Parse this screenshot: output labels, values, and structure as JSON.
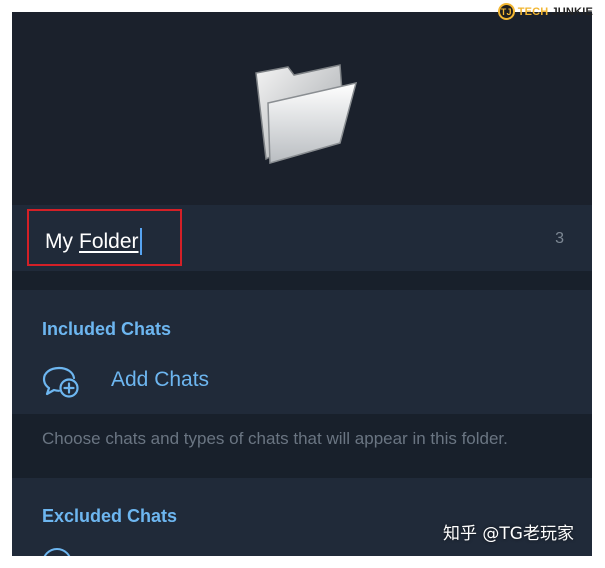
{
  "watermark": {
    "logo": "TJ",
    "brand_a": "TECH",
    "brand_b": "JUNKIE"
  },
  "folder": {
    "icon": "folder-icon"
  },
  "name_field": {
    "value_part1": "My",
    "value_part2": "Folder",
    "char_count": "3"
  },
  "included": {
    "title": "Included Chats",
    "add_label": "Add Chats",
    "add_icon": "add-chat-icon",
    "info": "Choose chats and types of chats that will appear in this folder."
  },
  "excluded": {
    "title": "Excluded Chats"
  },
  "overlay": {
    "text": "知乎 @TG老玩家"
  },
  "colors": {
    "accent": "#6db6f0",
    "background": "#1b2230",
    "highlight_box": "#d42027"
  }
}
